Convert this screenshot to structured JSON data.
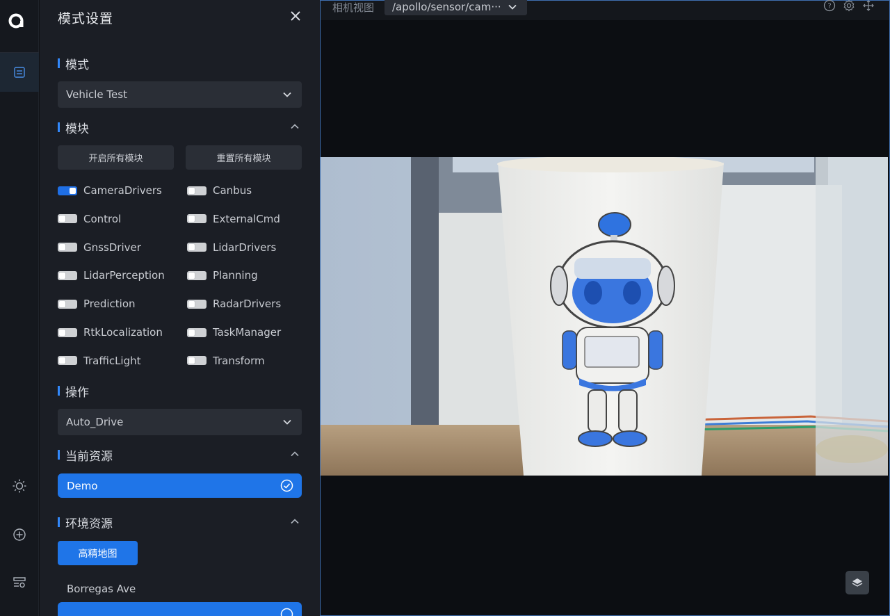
{
  "panel": {
    "title": "模式设置",
    "mode_section": {
      "title": "模式",
      "selected": "Vehicle Test"
    },
    "modules_section": {
      "title": "模块",
      "enable_all_label": "开启所有模块",
      "reset_all_label": "重置所有模块",
      "modules": [
        {
          "name": "CameraDrivers",
          "enabled": true
        },
        {
          "name": "Canbus",
          "enabled": false
        },
        {
          "name": "Control",
          "enabled": false
        },
        {
          "name": "ExternalCmd",
          "enabled": false
        },
        {
          "name": "GnssDriver",
          "enabled": false
        },
        {
          "name": "LidarDrivers",
          "enabled": false
        },
        {
          "name": "LidarPerception",
          "enabled": false
        },
        {
          "name": "Planning",
          "enabled": false
        },
        {
          "name": "Prediction",
          "enabled": false
        },
        {
          "name": "RadarDrivers",
          "enabled": false
        },
        {
          "name": "RtkLocalization",
          "enabled": false
        },
        {
          "name": "TaskManager",
          "enabled": false
        },
        {
          "name": "TrafficLight",
          "enabled": false
        },
        {
          "name": "Transform",
          "enabled": false
        }
      ]
    },
    "operation_section": {
      "title": "操作",
      "selected": "Auto_Drive"
    },
    "current_resource_section": {
      "title": "当前资源",
      "selected_item": "Demo"
    },
    "env_resource_section": {
      "title": "环境资源",
      "tab_label": "高精地图",
      "items": [
        "Borregas Ave"
      ]
    }
  },
  "camera": {
    "title": "相机视图",
    "channel": "/apollo/sensor/cam···"
  },
  "colors": {
    "accent": "#1f75e8",
    "panel_bg": "#1b1e25",
    "rail_bg": "#15181e"
  },
  "icons": {
    "rail": [
      "apollo-logo-icon",
      "mode-settings-icon",
      "sun-icon",
      "add-circle-icon",
      "resource-manager-icon"
    ],
    "camera_header": [
      "help-icon",
      "settings-icon",
      "move-icon"
    ],
    "layers": "layers-icon"
  }
}
